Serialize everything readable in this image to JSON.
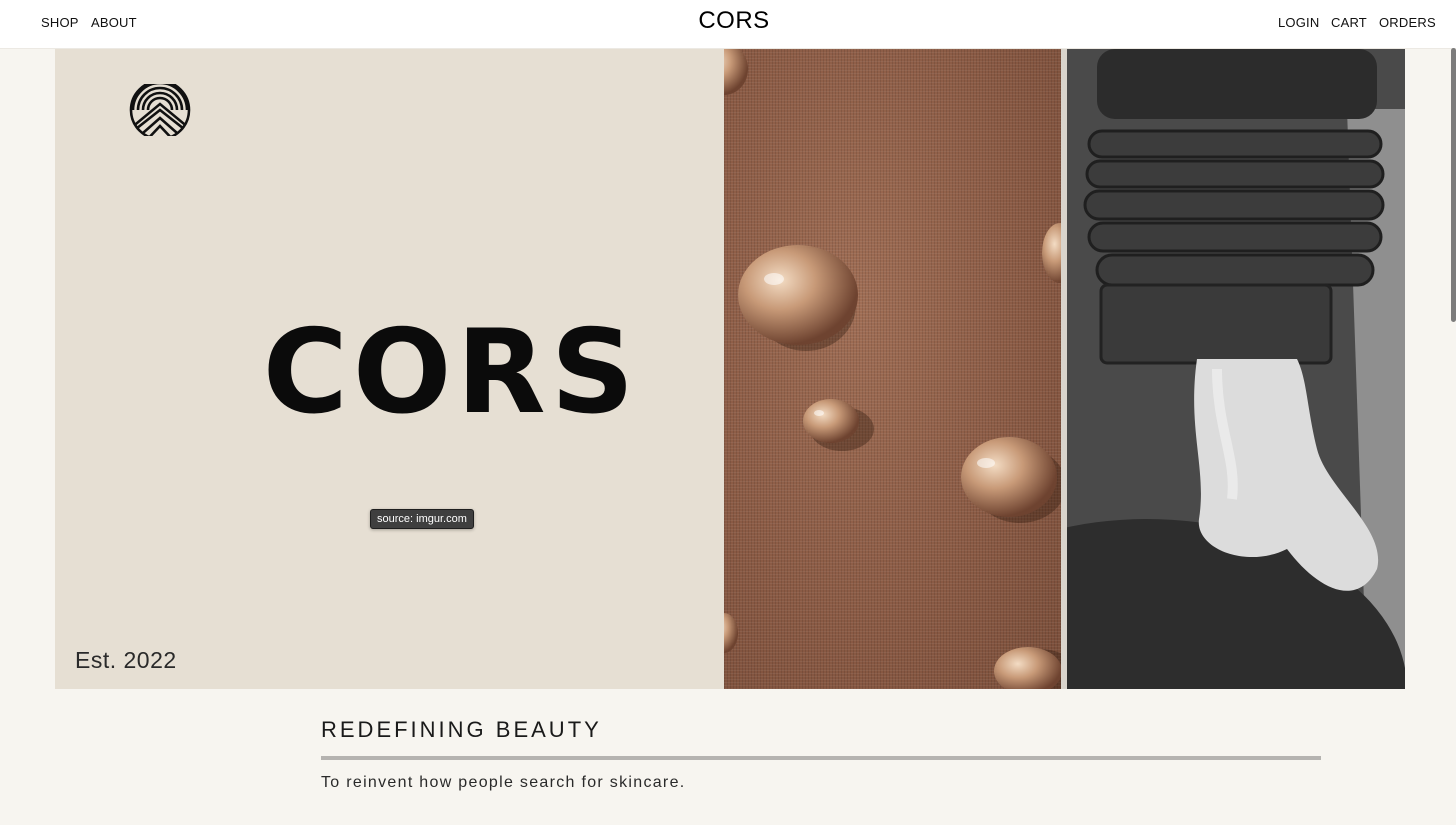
{
  "header": {
    "nav_left": [
      {
        "label": "SHOP"
      },
      {
        "label": "ABOUT"
      }
    ],
    "brand": "CORS",
    "nav_right": [
      {
        "label": "LOGIN"
      },
      {
        "label": "CART"
      },
      {
        "label": "ORDERS"
      }
    ]
  },
  "hero": {
    "logo_icon": "mountain-sun-emblem-icon",
    "wordmark": "CORS",
    "tooltip": "source: imgur.com",
    "established": "Est. 2022",
    "photos": [
      {
        "name": "water-droplets-on-fabric-photo"
      },
      {
        "name": "skincare-tube-with-cream-photo"
      }
    ]
  },
  "mission": {
    "title": "REDEFINING BEAUTY",
    "text": "To reinvent how people search for skincare."
  },
  "colors": {
    "page_background": "#f7f5f0",
    "hero_panel": "#e6dfd3",
    "fabric_brown": "#8e5f49",
    "rule_gray": "#b5b3b0"
  }
}
